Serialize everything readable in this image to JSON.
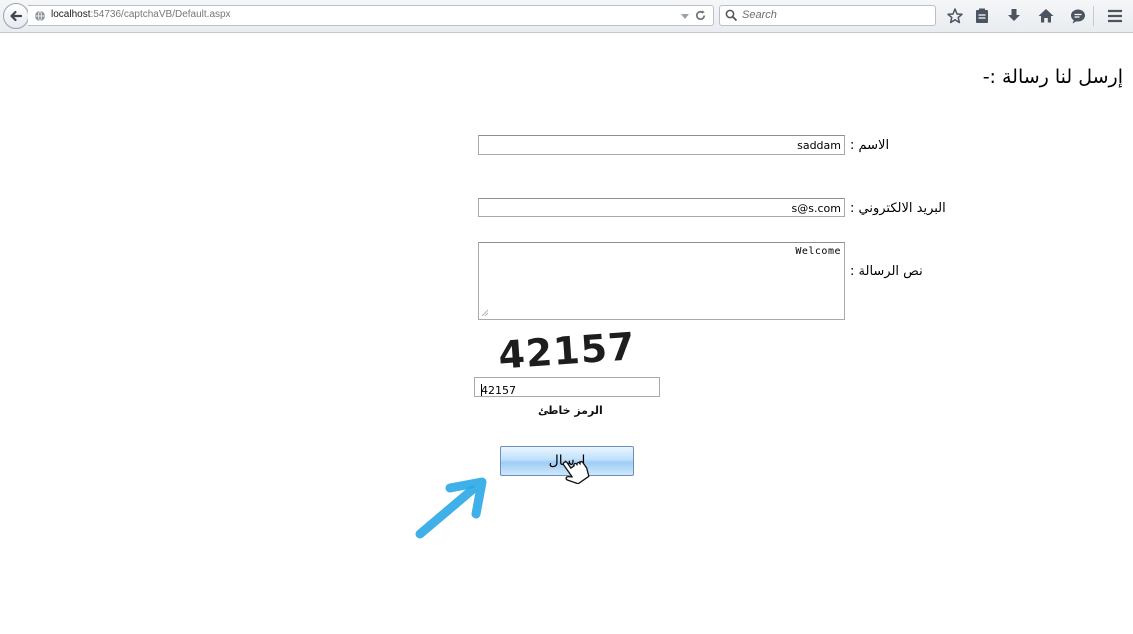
{
  "browser": {
    "url_host": "localhost",
    "url_rest": ":54736/captchaVB/Default.aspx",
    "search_placeholder": "Search",
    "icons": [
      "back-icon",
      "globe-icon",
      "dropdown-icon",
      "reload-icon",
      "search-icon",
      "star-icon",
      "reading-list-icon",
      "download-icon",
      "home-icon",
      "chat-icon",
      "menu-icon"
    ]
  },
  "page": {
    "heading": "إرسل لنا رسالة :-",
    "form": {
      "name_label": "الاسم :",
      "name_value": "saddam",
      "email_label": "البريد الالكتروني :",
      "email_value": "s@s.com",
      "message_label": "نص الرسالة :",
      "message_value": "Welcome",
      "captcha_image_text": "42157",
      "captcha_input_value": "42157",
      "captcha_error": "الرمز خاطئ",
      "submit_label": "إرسال"
    }
  },
  "colors": {
    "button_gradient_top": "#eaf5ff",
    "button_gradient_mid": "#9fcdf5",
    "annotation_arrow": "#2aa8e6"
  }
}
